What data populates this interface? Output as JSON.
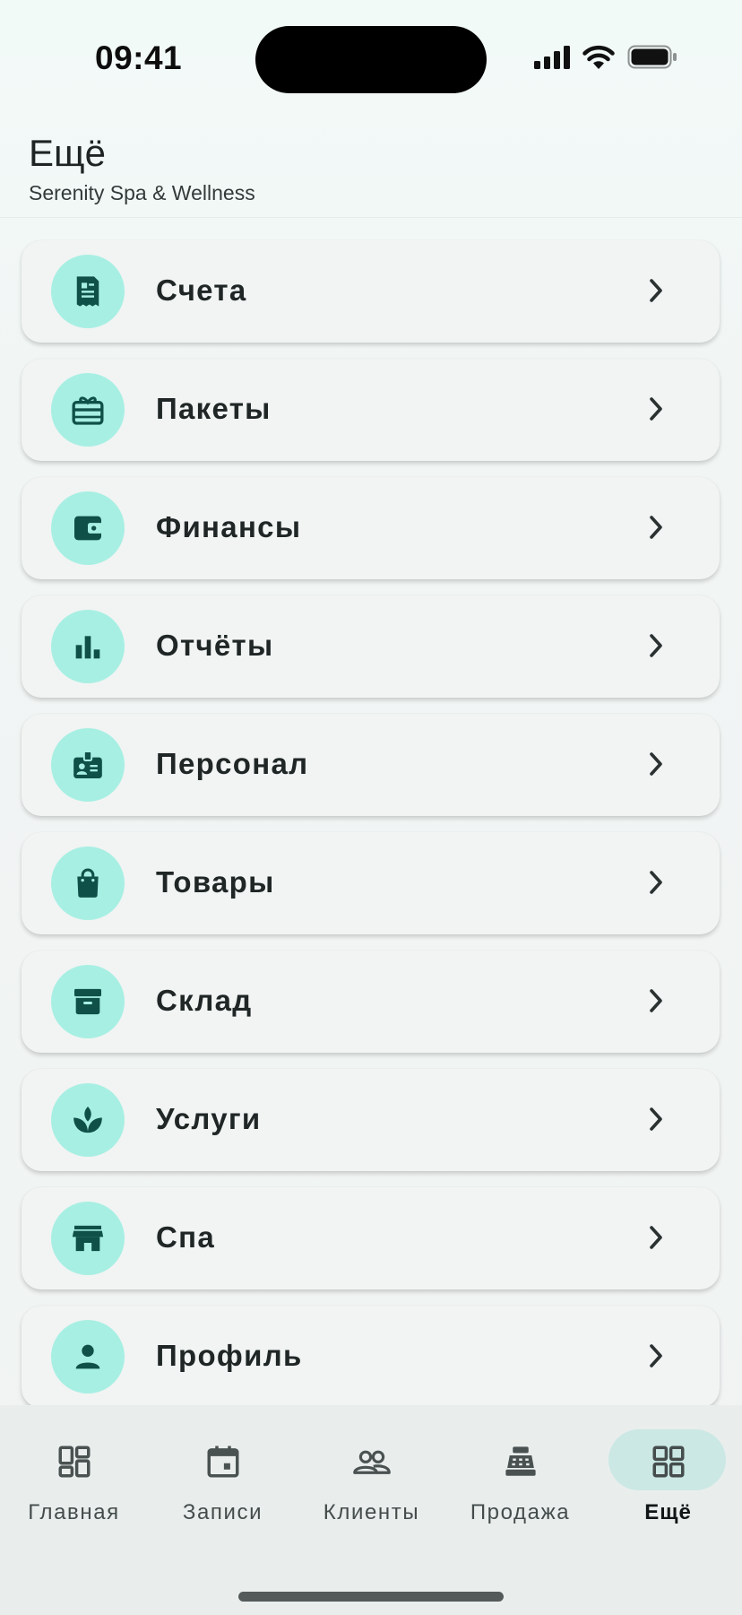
{
  "status_bar": {
    "time": "09:41"
  },
  "header": {
    "title": "Ещё",
    "subtitle": "Serenity Spa & Wellness"
  },
  "menu": {
    "items": [
      {
        "label": "Счета",
        "icon": "invoice-icon"
      },
      {
        "label": "Пакеты",
        "icon": "gift-card-icon"
      },
      {
        "label": "Финансы",
        "icon": "wallet-icon"
      },
      {
        "label": "Отчёты",
        "icon": "bar-chart-icon"
      },
      {
        "label": "Персонал",
        "icon": "badge-icon"
      },
      {
        "label": "Товары",
        "icon": "shopping-bag-icon"
      },
      {
        "label": "Склад",
        "icon": "archive-icon"
      },
      {
        "label": "Услуги",
        "icon": "spa-lotus-icon"
      },
      {
        "label": "Спа",
        "icon": "storefront-icon"
      },
      {
        "label": "Профиль",
        "icon": "person-icon"
      }
    ]
  },
  "bottom_nav": {
    "items": [
      {
        "label": "Главная",
        "icon": "dashboard-icon",
        "active": false
      },
      {
        "label": "Записи",
        "icon": "calendar-icon",
        "active": false
      },
      {
        "label": "Клиенты",
        "icon": "people-icon",
        "active": false
      },
      {
        "label": "Продажа",
        "icon": "cash-register-icon",
        "active": false
      },
      {
        "label": "Ещё",
        "icon": "grid-icon",
        "active": true
      }
    ]
  },
  "colors": {
    "accent_circle": "#a8efe3",
    "icon_dark": "#0f5048",
    "active_pill": "#cbe8e4",
    "card_bg": "#f1f4f3"
  }
}
